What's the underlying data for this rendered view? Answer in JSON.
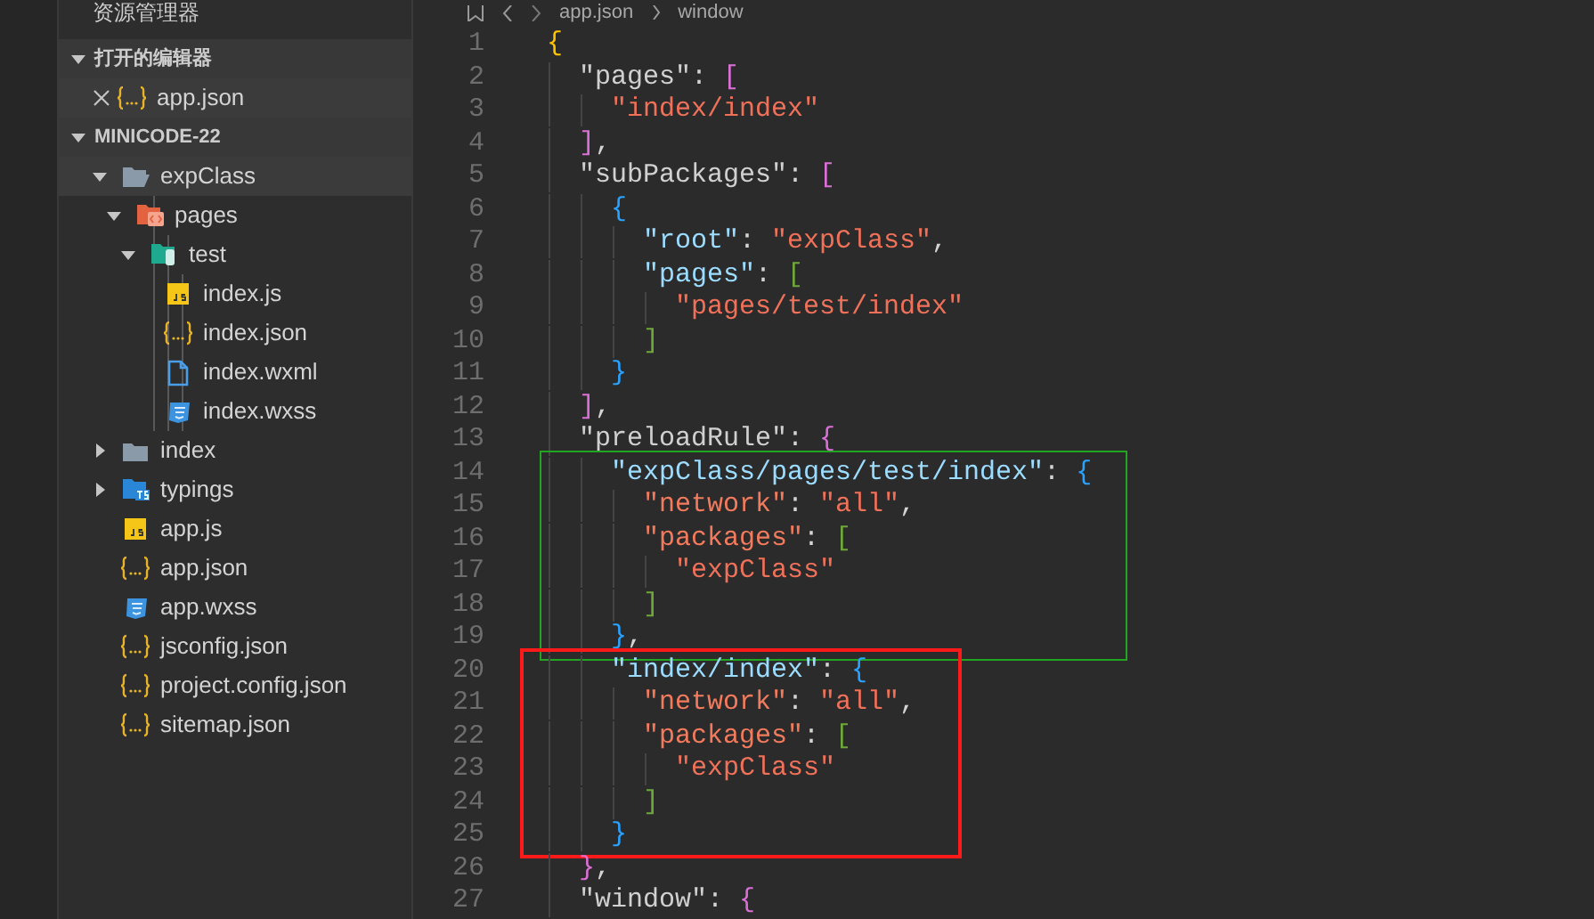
{
  "sidebar": {
    "title": "资源管理器",
    "open_editors": {
      "label": "打开的编辑器",
      "expanded": true,
      "items": [
        {
          "label": "app.json",
          "kind": "json",
          "selected": true
        }
      ]
    },
    "project": {
      "label": "MINICODE-22",
      "expanded": true,
      "tree": [
        {
          "label": "expClass",
          "kind": "folder",
          "expanded": true,
          "selected": true,
          "children": [
            {
              "label": "pages",
              "kind": "folder-pages",
              "expanded": true,
              "selected": false,
              "children": [
                {
                  "label": "test",
                  "kind": "folder-test",
                  "expanded": true,
                  "selected": false,
                  "children": [
                    {
                      "label": "index.js",
                      "kind": "js",
                      "selected": false
                    },
                    {
                      "label": "index.json",
                      "kind": "json",
                      "selected": false
                    },
                    {
                      "label": "index.wxml",
                      "kind": "wxml",
                      "selected": false
                    },
                    {
                      "label": "index.wxss",
                      "kind": "wxss",
                      "selected": false
                    }
                  ]
                }
              ]
            }
          ]
        },
        {
          "label": "index",
          "kind": "folder",
          "expanded": false,
          "selected": false
        },
        {
          "label": "typings",
          "kind": "folder-ts",
          "expanded": false,
          "selected": false
        },
        {
          "label": "app.js",
          "kind": "js",
          "selected": false
        },
        {
          "label": "app.json",
          "kind": "json",
          "selected": false
        },
        {
          "label": "app.wxss",
          "kind": "wxss",
          "selected": false
        },
        {
          "label": "jsconfig.json",
          "kind": "json",
          "selected": false
        },
        {
          "label": "project.config.json",
          "kind": "json",
          "selected": false
        },
        {
          "label": "sitemap.json",
          "kind": "json",
          "selected": false
        }
      ]
    }
  },
  "editor": {
    "breadcrumb": [
      "app.json",
      "window"
    ],
    "lines": [
      {
        "kind": "line",
        "number": "1",
        "tokens": [
          {
            "kind": "bracket-gold",
            "text": "{"
          }
        ]
      },
      {
        "kind": "line",
        "number": "2",
        "tokens": [
          {
            "kind": "key-grey",
            "text": "\"pages\""
          },
          {
            "kind": "punct",
            "text": ":"
          },
          {
            "kind": "bracket-magenta",
            "text": "["
          }
        ]
      },
      {
        "kind": "line",
        "number": "3",
        "tokens": [
          {
            "kind": "string",
            "text": "\"index/index\""
          }
        ]
      },
      {
        "kind": "line",
        "number": "4",
        "tokens": [
          {
            "kind": "bracket-magenta",
            "text": "]"
          },
          {
            "kind": "punct",
            "text": ","
          }
        ]
      },
      {
        "kind": "line",
        "number": "5",
        "tokens": [
          {
            "kind": "key-grey",
            "text": "\"subPackages\""
          },
          {
            "kind": "punct",
            "text": ":"
          },
          {
            "kind": "bracket-magenta",
            "text": "["
          }
        ]
      },
      {
        "kind": "line",
        "number": "6",
        "tokens": [
          {
            "kind": "bracket-blue",
            "text": "{"
          }
        ]
      },
      {
        "kind": "line",
        "number": "7",
        "tokens": [
          {
            "kind": "key-blue",
            "text": "\"root\""
          },
          {
            "kind": "punct",
            "text": ":"
          },
          {
            "kind": "string",
            "text": "\"expClass\""
          },
          {
            "kind": "punct",
            "text": ","
          }
        ]
      },
      {
        "kind": "line",
        "number": "8",
        "tokens": [
          {
            "kind": "key-blue",
            "text": "\"pages\""
          },
          {
            "kind": "punct",
            "text": ":"
          },
          {
            "kind": "bracket-green",
            "text": "["
          }
        ]
      },
      {
        "kind": "line",
        "number": "9",
        "tokens": [
          {
            "kind": "string",
            "text": "\"pages/test/index\""
          }
        ]
      },
      {
        "kind": "line",
        "number": "10",
        "tokens": [
          {
            "kind": "bracket-green",
            "text": "]"
          }
        ]
      },
      {
        "kind": "line",
        "number": "11",
        "tokens": [
          {
            "kind": "bracket-blue",
            "text": "}"
          }
        ]
      },
      {
        "kind": "line",
        "number": "12",
        "tokens": [
          {
            "kind": "bracket-magenta",
            "text": "]"
          },
          {
            "kind": "punct",
            "text": ","
          }
        ]
      },
      {
        "kind": "line",
        "number": "13",
        "tokens": [
          {
            "kind": "key-grey",
            "text": "\"preloadRule\""
          },
          {
            "kind": "punct",
            "text": ":"
          },
          {
            "kind": "bracket-magenta",
            "text": "{"
          }
        ]
      },
      {
        "kind": "box",
        "color": "#22a622",
        "lines": [
          {
            "kind": "line",
            "number": "14",
            "tokens": [
              {
                "kind": "key-blue",
                "text": "\"expClass/pages/test/index\""
              },
              {
                "kind": "punct",
                "text": ":"
              },
              {
                "kind": "bracket-blue",
                "text": "{"
              }
            ]
          },
          {
            "kind": "line",
            "number": "15",
            "tokens": [
              {
                "kind": "key-orange",
                "text": "\"network\""
              },
              {
                "kind": "punct",
                "text": ":"
              },
              {
                "kind": "string",
                "text": "\"all\""
              },
              {
                "kind": "punct",
                "text": ","
              }
            ]
          },
          {
            "kind": "line",
            "number": "16",
            "tokens": [
              {
                "kind": "key-orange",
                "text": "\"packages\""
              },
              {
                "kind": "punct",
                "text": ":"
              },
              {
                "kind": "bracket-green",
                "text": "["
              }
            ]
          },
          {
            "kind": "line",
            "number": "17",
            "tokens": [
              {
                "kind": "string",
                "text": "\"expClass\""
              }
            ]
          },
          {
            "kind": "line",
            "number": "18",
            "tokens": [
              {
                "kind": "bracket-green",
                "text": "]"
              }
            ]
          },
          {
            "kind": "line",
            "number": "19",
            "tokens": [
              {
                "kind": "bracket-blue",
                "text": "}"
              },
              {
                "kind": "punct",
                "text": ","
              }
            ]
          }
        ]
      },
      {
        "kind": "box",
        "color": "#ff1a1a",
        "lines": [
          {
            "kind": "line",
            "number": "20",
            "tokens": [
              {
                "kind": "key-blue",
                "text": "\"index/index\""
              },
              {
                "kind": "punct",
                "text": ":"
              },
              {
                "kind": "bracket-blue",
                "text": "{"
              }
            ]
          },
          {
            "kind": "line",
            "number": "21",
            "tokens": [
              {
                "kind": "key-orange",
                "text": "\"network\""
              },
              {
                "kind": "punct",
                "text": ":"
              },
              {
                "kind": "string",
                "text": "\"all\""
              },
              {
                "kind": "punct",
                "text": ","
              }
            ]
          },
          {
            "kind": "line",
            "number": "22",
            "tokens": [
              {
                "kind": "key-orange",
                "text": "\"packages\""
              },
              {
                "kind": "punct",
                "text": ":"
              },
              {
                "kind": "bracket-green",
                "text": "["
              }
            ]
          },
          {
            "kind": "line",
            "number": "23",
            "tokens": [
              {
                "kind": "string",
                "text": "\"expClass\""
              }
            ]
          },
          {
            "kind": "line",
            "number": "24",
            "tokens": [
              {
                "kind": "bracket-green",
                "text": "]"
              }
            ]
          },
          {
            "kind": "line",
            "number": "25",
            "tokens": [
              {
                "kind": "bracket-blue",
                "text": "}"
              }
            ]
          }
        ]
      },
      {
        "kind": "line",
        "number": "26",
        "tokens": [
          {
            "kind": "bracket-magenta",
            "text": "}"
          },
          {
            "kind": "punct",
            "text": ","
          }
        ]
      },
      {
        "kind": "line",
        "number": "27",
        "tokens": [
          {
            "kind": "key-grey",
            "text": "\"window\""
          },
          {
            "kind": "punct",
            "text": ":"
          },
          {
            "kind": "bracket-magenta",
            "text": "{"
          }
        ]
      }
    ]
  }
}
